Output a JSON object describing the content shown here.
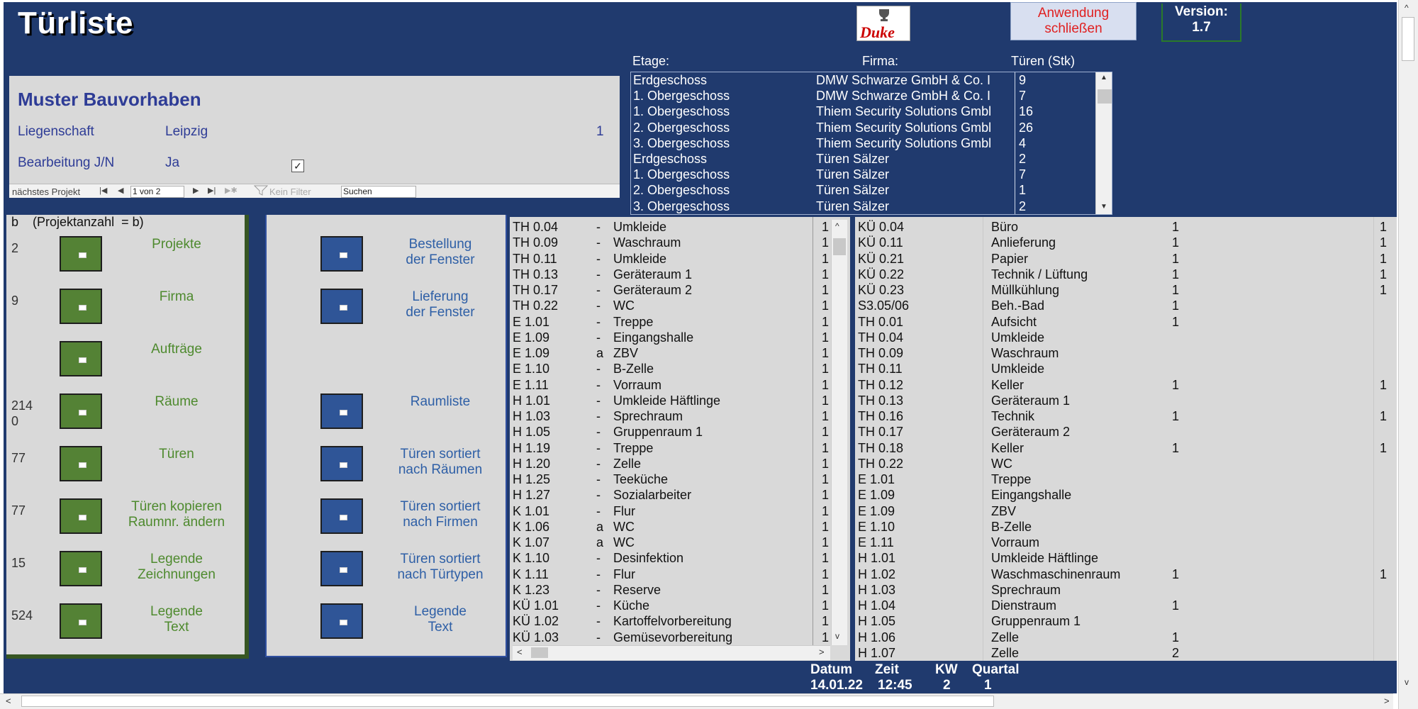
{
  "app": {
    "title": "Türliste",
    "logo_text": "Duke",
    "close_label_1": "Anwendung",
    "close_label_2": "schließen",
    "version_label": "Version:",
    "version_value": "1.7"
  },
  "header": {
    "col_etage": "Etage:",
    "col_firma": "Firma:",
    "col_tueren": "Türen (Stk)"
  },
  "project": {
    "title": "Muster Bauvorhaben",
    "liegenschaft_label": "Liegenschaft",
    "liegenschaft_value": "Leipzig",
    "id_value": "1",
    "bearbeitung_label": "Bearbeitung J/N",
    "bearbeitung_value": "Ja",
    "checkbox_mark": "✓",
    "nav": {
      "next_label": "nächstes Projekt",
      "first": "|◀",
      "prev": "◀",
      "record": "1 von 2",
      "next": "▶",
      "last": "▶|",
      "new": "▶✱",
      "filter_label": "Kein Filter",
      "search_placeholder": "Suchen"
    }
  },
  "floor_list": [
    [
      "Erdgeschoss",
      "DMW Schwarze GmbH & Co. I",
      "9"
    ],
    [
      "1. Obergeschoss",
      "DMW Schwarze GmbH & Co. I",
      "7"
    ],
    [
      "1. Obergeschoss",
      "Thiem Security Solutions Gmbl",
      "16"
    ],
    [
      "2. Obergeschoss",
      "Thiem Security Solutions Gmbl",
      "26"
    ],
    [
      "3. Obergeschoss",
      "Thiem Security Solutions Gmbl",
      "4"
    ],
    [
      "Erdgeschoss",
      "Türen Sälzer",
      "2"
    ],
    [
      "1. Obergeschoss",
      "Türen Sälzer",
      "7"
    ],
    [
      "2. Obergeschoss",
      "Türen Sälzer",
      "1"
    ],
    [
      "3. Obergeschoss",
      "Türen Sälzer",
      "2"
    ]
  ],
  "left_panel": {
    "header": "b    (Projektanzahl  = b)",
    "items": [
      {
        "count": "2",
        "label_1": "Projekte",
        "label_2": ""
      },
      {
        "count": "9",
        "label_1": "Firma",
        "label_2": ""
      },
      {
        "count": "",
        "label_1": "Aufträge",
        "label_2": ""
      },
      {
        "count": "214",
        "count_2": "0",
        "label_1": "Räume",
        "label_2": ""
      },
      {
        "count": "77",
        "label_1": "Türen",
        "label_2": ""
      },
      {
        "count": "77",
        "label_1": "Türen kopieren",
        "label_2": "Raumnr. ändern"
      },
      {
        "count": "15",
        "label_1": "Legende",
        "label_2": "Zeichnungen"
      },
      {
        "count": "524",
        "label_1": "Legende",
        "label_2": "Text"
      }
    ]
  },
  "mid_panel": {
    "items": [
      {
        "label_1": "Bestellung",
        "label_2": "der Fenster"
      },
      {
        "label_1": "Lieferung",
        "label_2": "der Fenster"
      },
      {
        "label_1": "Raumliste",
        "label_2": ""
      },
      {
        "label_1": "Türen sortiert",
        "label_2": "nach Räumen"
      },
      {
        "label_1": "Türen sortiert",
        "label_2": "nach Firmen"
      },
      {
        "label_1": "Türen sortiert",
        "label_2": "nach Türtypen"
      },
      {
        "label_1": "Legende",
        "label_2": "Text"
      }
    ]
  },
  "room_list": [
    [
      "TH 0.04",
      "-",
      "Umkleide",
      "1"
    ],
    [
      "TH 0.09",
      "-",
      "Waschraum",
      "1"
    ],
    [
      "TH 0.11",
      "-",
      "Umkleide",
      "1"
    ],
    [
      "TH 0.13",
      "-",
      "Geräteraum 1",
      "1"
    ],
    [
      "TH 0.17",
      "-",
      "Geräteraum 2",
      "1"
    ],
    [
      "TH 0.22",
      "-",
      "WC",
      "1"
    ],
    [
      "E 1.01",
      "-",
      "Treppe",
      "1"
    ],
    [
      "E 1.09",
      "-",
      "Eingangshalle",
      "1"
    ],
    [
      "E 1.09",
      "a",
      "ZBV",
      "1"
    ],
    [
      "E 1.10",
      "-",
      "B-Zelle",
      "1"
    ],
    [
      "E 1.11",
      "-",
      "Vorraum",
      "1"
    ],
    [
      "H 1.01",
      "-",
      "Umkleide Häftlinge",
      "1"
    ],
    [
      "H 1.03",
      "-",
      "Sprechraum",
      "1"
    ],
    [
      "H 1.05",
      "-",
      "Gruppenraum 1",
      "1"
    ],
    [
      "H 1.19",
      "-",
      "Treppe",
      "1"
    ],
    [
      "H 1.20",
      "-",
      "Zelle",
      "1"
    ],
    [
      "H 1.25",
      "-",
      "Teeküche",
      "1"
    ],
    [
      "H 1.27",
      "-",
      "Sozialarbeiter",
      "1"
    ],
    [
      "K 1.01",
      "-",
      "Flur",
      "1"
    ],
    [
      "K 1.06",
      "a",
      "WC",
      "1"
    ],
    [
      "K 1.07",
      "a",
      "WC",
      "1"
    ],
    [
      "K 1.10",
      "-",
      "Desinfektion",
      "1"
    ],
    [
      "K 1.11",
      "-",
      "Flur",
      "1"
    ],
    [
      "K 1.23",
      "-",
      "Reserve",
      "1"
    ],
    [
      "KÜ 1.01",
      "-",
      "Küche",
      "1"
    ],
    [
      "KÜ 1.02",
      "-",
      "Kartoffelvorbereitung",
      "1"
    ],
    [
      "KÜ 1.03",
      "-",
      "Gemüsevorbereitung",
      "1"
    ]
  ],
  "right_list": [
    [
      "KÜ 0.04",
      "Büro",
      "1",
      "1"
    ],
    [
      "KÜ 0.11",
      "Anlieferung",
      "1",
      "1"
    ],
    [
      "KÜ 0.21",
      "Papier",
      "1",
      "1"
    ],
    [
      "KÜ 0.22",
      "Technik / Lüftung",
      "1",
      "1"
    ],
    [
      "KÜ 0.23",
      "Müllkühlung",
      "1",
      "1"
    ],
    [
      "S3.05/06",
      "Beh.-Bad",
      "1",
      ""
    ],
    [
      "TH 0.01",
      "Aufsicht",
      "1",
      ""
    ],
    [
      "TH 0.04",
      "Umkleide",
      "",
      ""
    ],
    [
      "TH 0.09",
      "Waschraum",
      "",
      ""
    ],
    [
      "TH 0.11",
      "Umkleide",
      "",
      ""
    ],
    [
      "TH 0.12",
      "Keller",
      "1",
      "1"
    ],
    [
      "TH 0.13",
      "Geräteraum 1",
      "",
      ""
    ],
    [
      "TH 0.16",
      "Technik",
      "1",
      "1"
    ],
    [
      "TH 0.17",
      "Geräteraum 2",
      "",
      ""
    ],
    [
      "TH 0.18",
      "Keller",
      "1",
      "1"
    ],
    [
      "TH 0.22",
      "WC",
      "",
      ""
    ],
    [
      "E 1.01",
      "Treppe",
      "",
      ""
    ],
    [
      "E 1.09",
      "Eingangshalle",
      "",
      ""
    ],
    [
      "E 1.09",
      "ZBV",
      "",
      ""
    ],
    [
      "E 1.10",
      "B-Zelle",
      "",
      ""
    ],
    [
      "E 1.11",
      "Vorraum",
      "",
      ""
    ],
    [
      "H 1.01",
      "Umkleide Häftlinge",
      "",
      ""
    ],
    [
      "H 1.02",
      "Waschmaschinenraum",
      "1",
      "1"
    ],
    [
      "H 1.03",
      "Sprechraum",
      "",
      ""
    ],
    [
      "H 1.04",
      "Dienstraum",
      "1",
      ""
    ],
    [
      "H 1.05",
      "Gruppenraum 1",
      "",
      ""
    ],
    [
      "H 1.06",
      "Zelle",
      "1",
      ""
    ],
    [
      "H 1.07",
      "Zelle",
      "2",
      ""
    ]
  ],
  "footer": {
    "datum_label": "Datum",
    "datum_value": "14.01.22",
    "zeit_label": "Zeit",
    "zeit_value": "12:45",
    "kw_label": "KW",
    "kw_value": "2",
    "quartal_label": "Quartal",
    "quartal_value": "1"
  },
  "colors": {
    "navy": "#203a6e",
    "panel_gray": "#d9d9d9",
    "green_button": "#548235",
    "blue_button": "#2f5597",
    "close_text": "#e02020"
  }
}
